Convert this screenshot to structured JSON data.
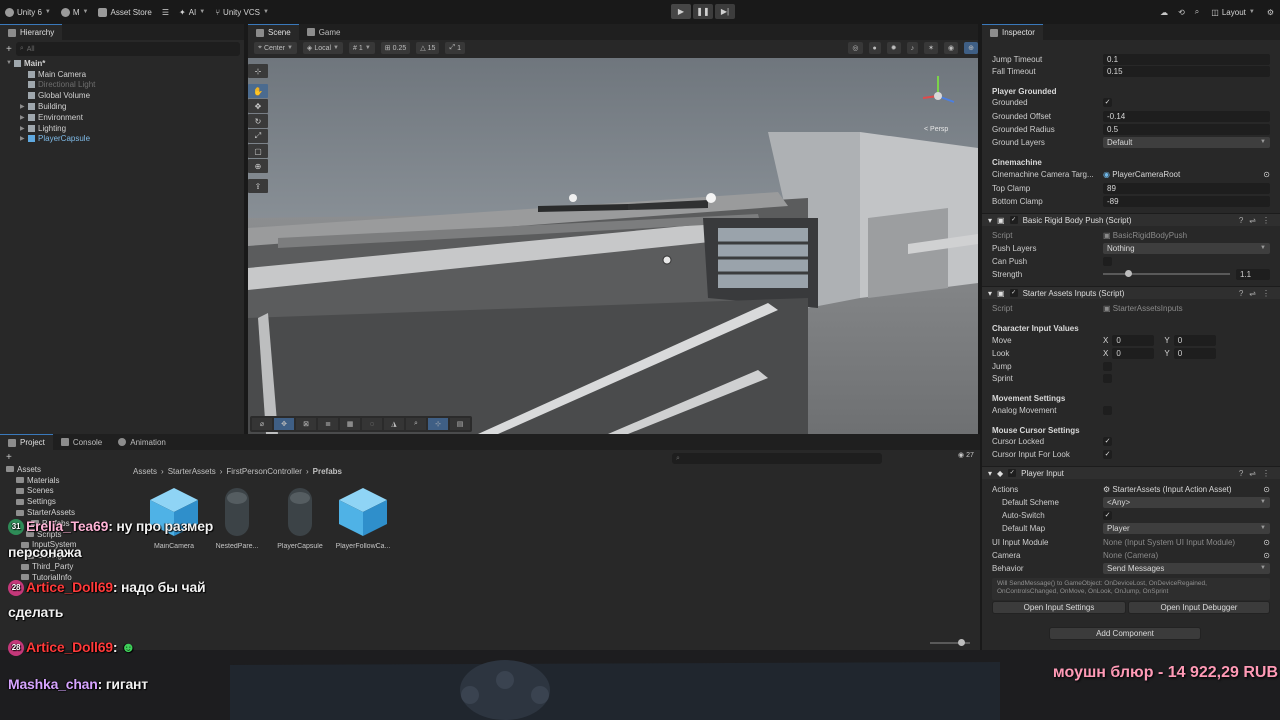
{
  "toolbar": {
    "account": "Unity 6",
    "user": "M",
    "asset_store": "Asset Store",
    "ai": "AI",
    "vcs": "Unity VCS",
    "layout": "Layout"
  },
  "hierarchy": {
    "tab": "Hierarchy",
    "search_placeholder": "All",
    "scene": "Main*",
    "items": [
      {
        "label": "Main Camera",
        "dim": false,
        "blue": false
      },
      {
        "label": "Directional Light",
        "dim": true,
        "blue": false
      },
      {
        "label": "Global Volume",
        "dim": false,
        "blue": false
      },
      {
        "label": "Building",
        "dim": false,
        "blue": false
      },
      {
        "label": "Environment",
        "dim": false,
        "blue": false
      },
      {
        "label": "Lighting",
        "dim": false,
        "blue": false
      },
      {
        "label": "PlayerCapsule",
        "dim": false,
        "blue": true
      }
    ]
  },
  "scene": {
    "tab_scene": "Scene",
    "tab_game": "Game",
    "pivot": "Center",
    "space": "Local",
    "grid_value": "1",
    "snap_value": "0.25",
    "rotate_snap": "15",
    "scale_snap": "1",
    "persp_label": "< Persp"
  },
  "inspector": {
    "tab": "Inspector",
    "jump_timeout_label": "Jump Timeout",
    "jump_timeout": "0.1",
    "fall_timeout_label": "Fall Timeout",
    "fall_timeout": "0.15",
    "player_grounded": "Player Grounded",
    "grounded_label": "Grounded",
    "grounded_offset_label": "Grounded Offset",
    "grounded_offset": "-0.14",
    "grounded_radius_label": "Grounded Radius",
    "grounded_radius": "0.5",
    "ground_layers_label": "Ground Layers",
    "ground_layers": "Default",
    "cinemachine": "Cinemachine",
    "cam_target_label": "Cinemachine Camera Targ...",
    "cam_target": "PlayerCameraRoot",
    "top_clamp_label": "Top Clamp",
    "top_clamp": "89",
    "bottom_clamp_label": "Bottom Clamp",
    "bottom_clamp": "-89",
    "comp1": "Basic Rigid Body Push (Script)",
    "script_label": "Script",
    "comp1_script": "BasicRigidBodyPush",
    "push_layers_label": "Push Layers",
    "push_layers": "Nothing",
    "can_push_label": "Can Push",
    "strength_label": "Strength",
    "strength": "1.1",
    "strength_fraction": 0.2,
    "comp2": "Starter Assets Inputs (Script)",
    "comp2_script": "StarterAssetsInputs",
    "char_input": "Character Input Values",
    "move_label": "Move",
    "look_label": "Look",
    "x_label": "X",
    "y_label": "Y",
    "move_x": "0",
    "move_y": "0",
    "look_x": "0",
    "look_y": "0",
    "jump_label": "Jump",
    "sprint_label": "Sprint",
    "movement_settings": "Movement Settings",
    "analog_label": "Analog Movement",
    "mouse_cursor": "Mouse Cursor Settings",
    "cursor_locked_label": "Cursor Locked",
    "cursor_input_label": "Cursor Input For Look",
    "comp3": "Player Input",
    "actions_label": "Actions",
    "actions": "StarterAssets (Input Action Asset)",
    "default_scheme_label": "Default Scheme",
    "default_scheme": "<Any>",
    "auto_switch_label": "Auto-Switch",
    "default_map_label": "Default Map",
    "default_map": "Player",
    "ui_module_label": "UI Input Module",
    "ui_module": "None (Input System UI Input Module)",
    "camera_label": "Camera",
    "camera": "None (Camera)",
    "behavior_label": "Behavior",
    "behavior": "Send Messages",
    "help_text": "Will SendMessage() to GameObject: OnDeviceLost, OnDeviceRegained, OnControlsChanged, OnMove, OnLook, OnJump, OnSprint",
    "open_settings": "Open Input Settings",
    "open_debugger": "Open Input Debugger",
    "add_component": "Add Component"
  },
  "project": {
    "tab_project": "Project",
    "tab_console": "Console",
    "tab_animation": "Animation",
    "breadcrumb": [
      "Assets",
      "StarterAssets",
      "FirstPersonController",
      "Prefabs"
    ],
    "badge_count": "27",
    "tree": [
      {
        "label": "Assets",
        "indent": 0
      },
      {
        "label": "Materials",
        "indent": 2
      },
      {
        "label": "Scenes",
        "indent": 2
      },
      {
        "label": "Settings",
        "indent": 2
      },
      {
        "label": "StarterAssets",
        "indent": 2
      },
      {
        "label": "Prefabs",
        "indent": 5
      },
      {
        "label": "Scripts",
        "indent": 4
      },
      {
        "label": "InputSystem",
        "indent": 3
      },
      {
        "label": "Settings",
        "indent": 4
      },
      {
        "label": "Third_Party",
        "indent": 3
      },
      {
        "label": "TutorialInfo",
        "indent": 3
      }
    ],
    "assets": [
      {
        "label": "MainCamera",
        "kind": "cube"
      },
      {
        "label": "NestedPare...",
        "kind": "capsule"
      },
      {
        "label": "PlayerCapsule",
        "kind": "capsule"
      },
      {
        "label": "PlayerFollowCa...",
        "kind": "cube"
      }
    ]
  },
  "chat": {
    "m1_badge": "31",
    "m1_nick": "Erelia_Tea69",
    "m1_text": "ну про размер",
    "m1_text2": "персонажа",
    "m2_badge": "28",
    "m2_nick": "Artice_Doll69",
    "m2_text": "надо бы чай",
    "m2_text2": "сделать",
    "m3_badge": "28",
    "m3_nick": "Artice_Doll69",
    "m4_nick": "Mashka_chan",
    "m4_text": "гигант",
    "donation": "моушн блюр - 14 922,29 RUB"
  }
}
